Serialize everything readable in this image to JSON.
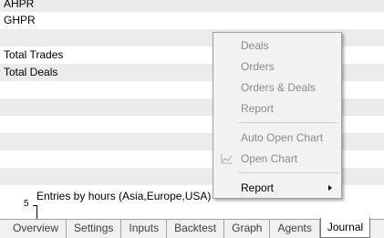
{
  "rows": [
    {
      "label": "AHPR"
    },
    {
      "label": "GHPR"
    },
    {
      "label": ""
    },
    {
      "label": "Total Trades"
    },
    {
      "label": "Total Deals"
    },
    {
      "label": ""
    },
    {
      "label": ""
    },
    {
      "label": ""
    },
    {
      "label": ""
    },
    {
      "label": ""
    },
    {
      "label": ""
    }
  ],
  "chart": {
    "title": "Entries by hours (Asia,Europe,USA)",
    "y_tick_label": "5"
  },
  "tabs": [
    "Overview",
    "Settings",
    "Inputs",
    "Backtest",
    "Graph",
    "Agents",
    "Journal"
  ],
  "active_tab": "Journal",
  "context_menu": {
    "items": [
      {
        "label": "Deals",
        "enabled": false
      },
      {
        "label": "Orders",
        "enabled": false
      },
      {
        "label": "Orders & Deals",
        "enabled": false
      },
      {
        "label": "Report",
        "enabled": false
      },
      {
        "label": "Auto Open Chart",
        "enabled": false
      },
      {
        "label": "Open Chart",
        "enabled": false,
        "icon": "chart-line-icon"
      },
      {
        "label": "Report",
        "enabled": true,
        "submenu": true
      }
    ]
  }
}
